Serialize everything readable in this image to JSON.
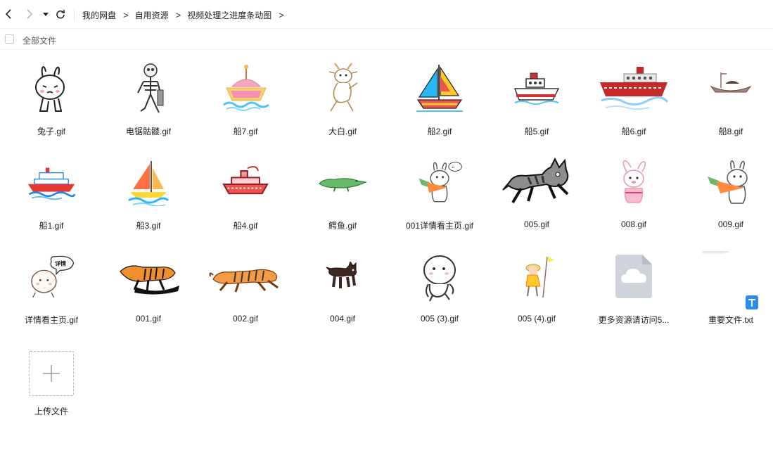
{
  "breadcrumb": [
    "我的网盘",
    "自用资源",
    "视频处理之进度条动图"
  ],
  "breadcrumb_separator": ">",
  "toolbar": {
    "select_all_label": "全部文件"
  },
  "files": [
    {
      "name": "兔子.gif",
      "icon": "rabbit-sad"
    },
    {
      "name": "电锯骷髅.gif",
      "icon": "skeleton"
    },
    {
      "name": "船7.gif",
      "icon": "ship-ice-cream"
    },
    {
      "name": "大白.gif",
      "icon": "goat-walking"
    },
    {
      "name": "船2.gif",
      "icon": "sailboat-colorful"
    },
    {
      "name": "船5.gif",
      "icon": "tugboat"
    },
    {
      "name": "船6.gif",
      "icon": "cruise-ship-red"
    },
    {
      "name": "船8.gif",
      "icon": "fishing-boat"
    },
    {
      "name": "船1.gif",
      "icon": "cruise-ship-blue"
    },
    {
      "name": "船3.gif",
      "icon": "sailboat-orange"
    },
    {
      "name": "船4.gif",
      "icon": "pixel-ship"
    },
    {
      "name": "鳄鱼.gif",
      "icon": "crocodile"
    },
    {
      "name": "001详情看主页.gif",
      "icon": "rabbit-carrot-bubble"
    },
    {
      "name": "005.gif",
      "icon": "cat-running"
    },
    {
      "name": "008.gif",
      "icon": "rabbit-pink"
    },
    {
      "name": "009.gif",
      "icon": "rabbit-carrot"
    },
    {
      "name": "详情看主页.gif",
      "icon": "bun-speech"
    },
    {
      "name": "001.gif",
      "icon": "tiger-shadow"
    },
    {
      "name": "002.gif",
      "icon": "tiger-running"
    },
    {
      "name": "004.gif",
      "icon": "dog"
    },
    {
      "name": "005 (3).gif",
      "icon": "bun-running"
    },
    {
      "name": "005 (4).gif",
      "icon": "girl-flag"
    },
    {
      "name": "更多资源请访问5...",
      "icon": "cloud-file"
    },
    {
      "name": "重要文件.txt",
      "icon": "txt-file"
    }
  ],
  "speech_bubble_text": "详情",
  "upload": {
    "label": "上传文件",
    "icon": "plus-icon"
  }
}
